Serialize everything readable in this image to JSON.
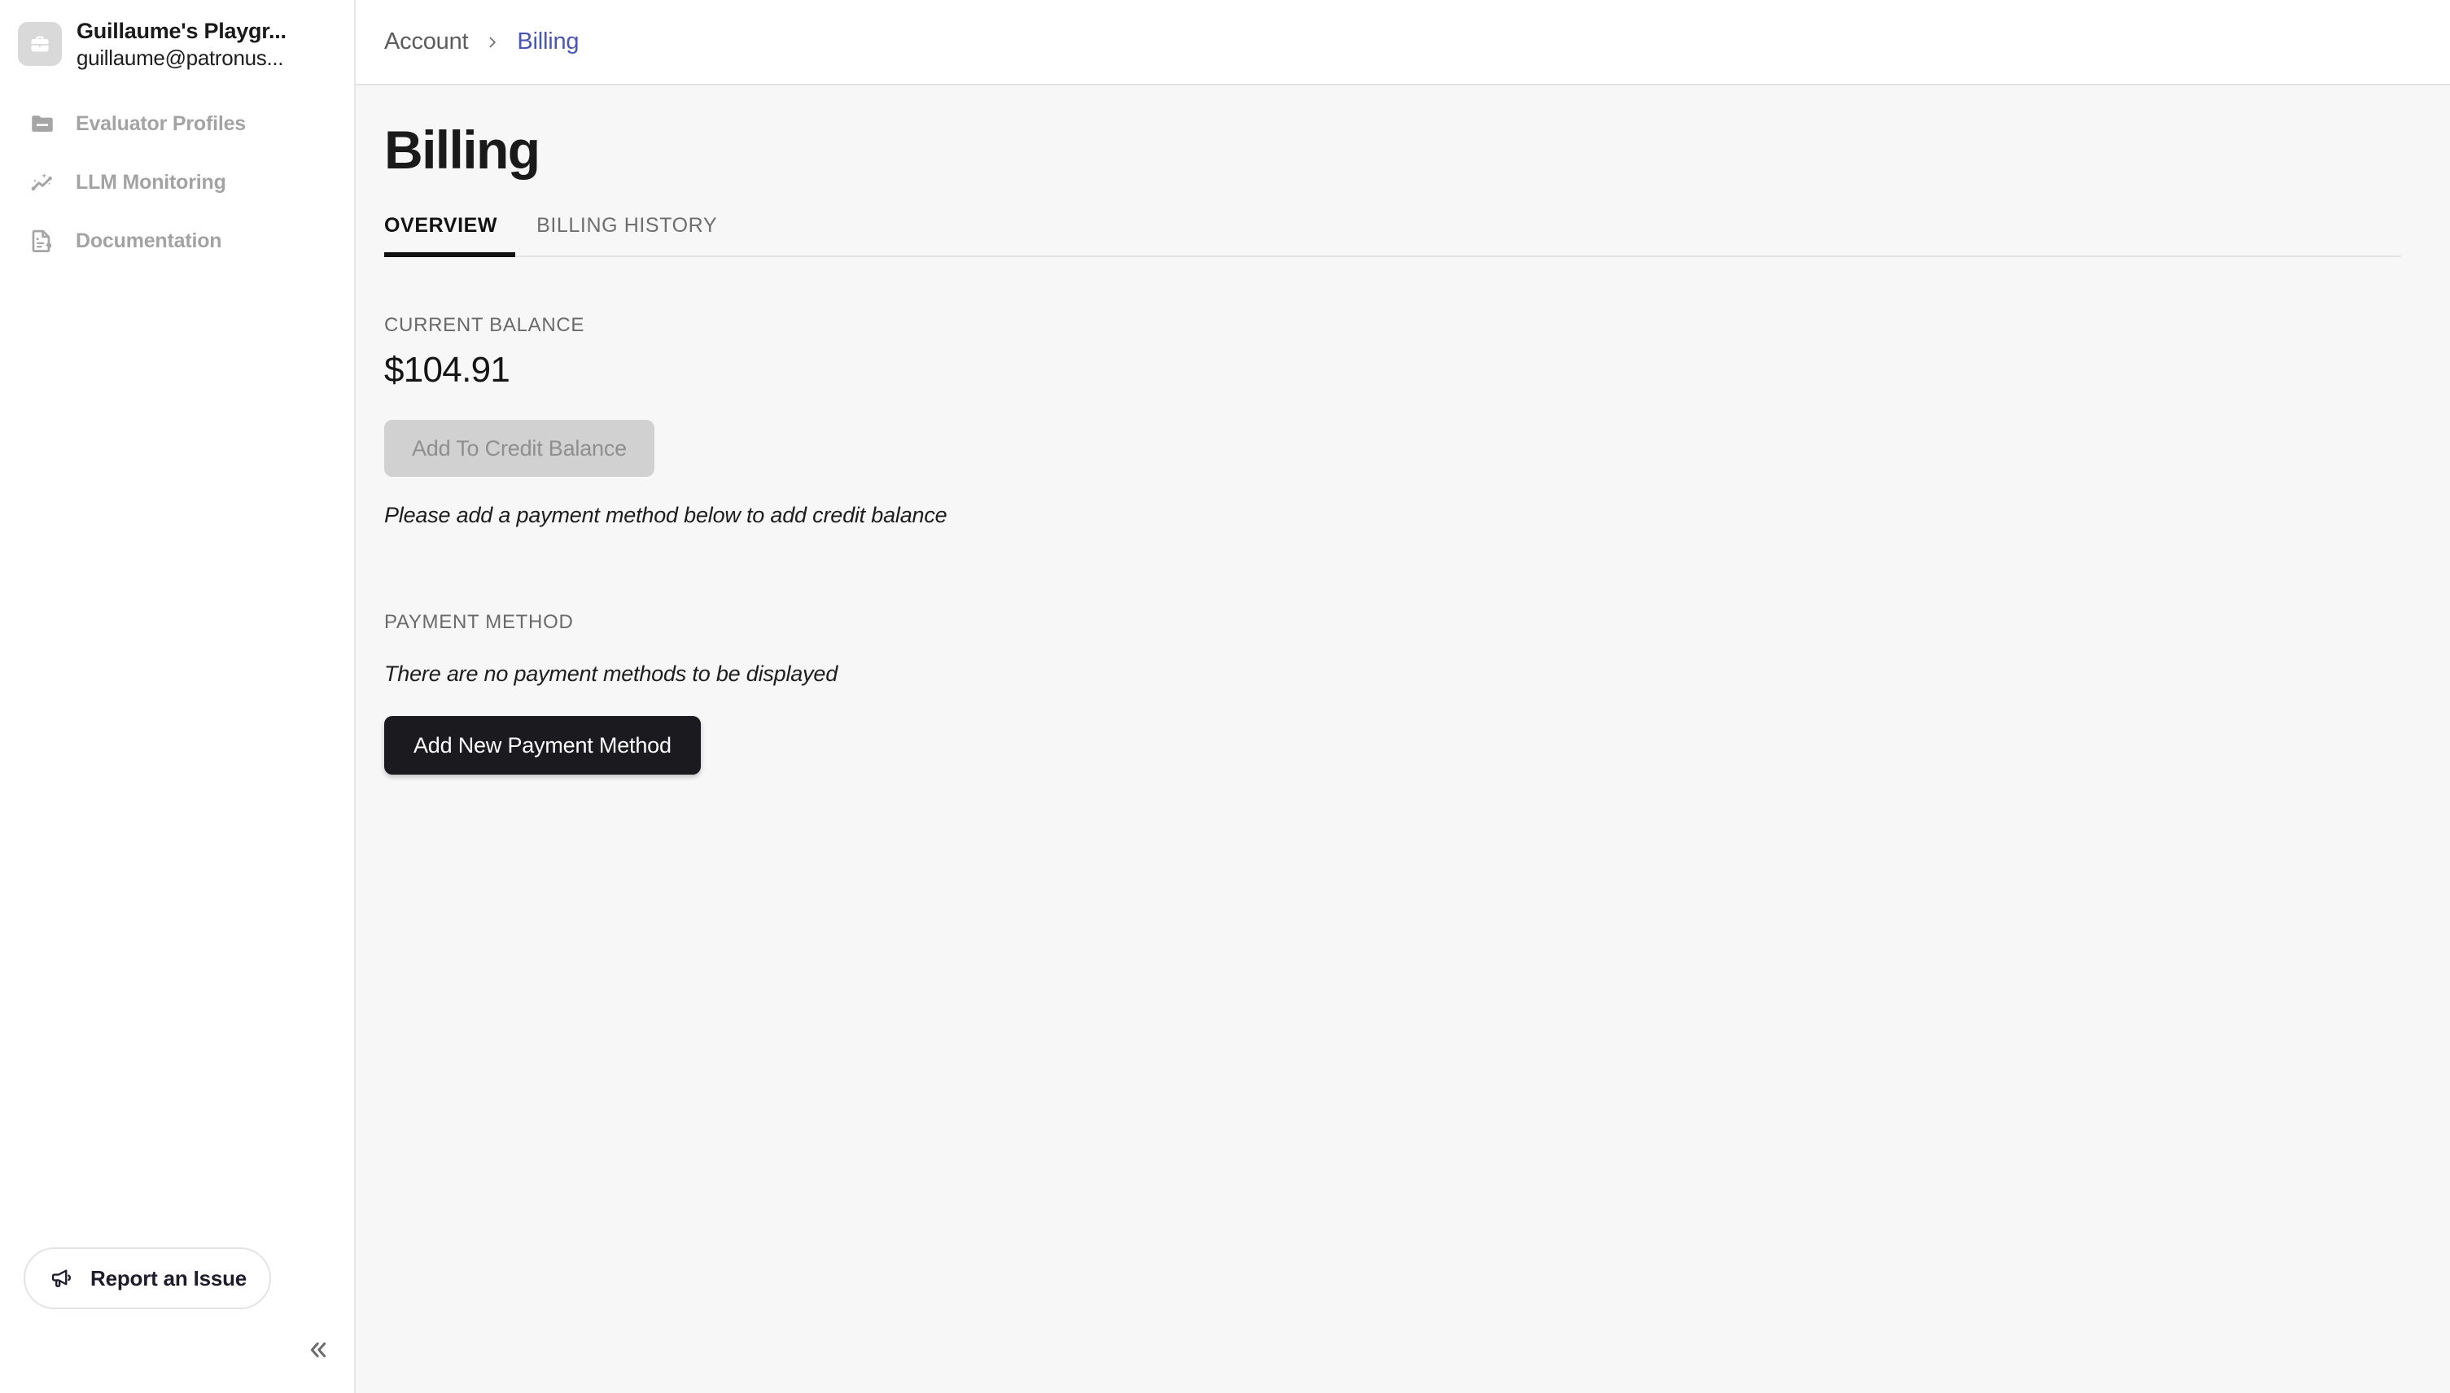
{
  "sidebar": {
    "account": {
      "avatar_icon": "briefcase-icon",
      "name": "Guillaume's Playgr...",
      "email": "guillaume@patronus..."
    },
    "items": [
      {
        "label": "Evaluator Profiles",
        "icon": "folder-icon"
      },
      {
        "label": "LLM Monitoring",
        "icon": "sparkle-line-chart-icon"
      },
      {
        "label": "Documentation",
        "icon": "document-question-icon"
      }
    ],
    "report_issue": {
      "label": "Report an Issue",
      "icon": "megaphone-icon"
    },
    "collapse": {
      "icon": "double-chevron-left-icon"
    }
  },
  "topbar": {
    "breadcrumb": [
      {
        "label": "Account",
        "current": false
      },
      {
        "label": "Billing",
        "current": true
      }
    ],
    "separator": "›"
  },
  "page": {
    "title": "Billing",
    "tabs": [
      {
        "label": "OVERVIEW",
        "active": true
      },
      {
        "label": "BILLING HISTORY",
        "active": false
      }
    ],
    "balance": {
      "label": "CURRENT BALANCE",
      "amount": "$104.91",
      "add_credit_button": "Add To Credit Balance",
      "hint": "Please add a payment method below to add credit balance"
    },
    "payment": {
      "label": "PAYMENT METHOD",
      "empty_text": "There are no payment methods to be displayed",
      "add_button": "Add New Payment Method"
    }
  },
  "colors": {
    "breadcrumb_active": "#4a56b5",
    "primary_button_bg": "#1a1a1f",
    "disabled_button_bg": "#d1d1d1",
    "sidebar_bg": "#ffffff",
    "content_bg": "#f7f7f7",
    "tab_underline": "#101010"
  }
}
